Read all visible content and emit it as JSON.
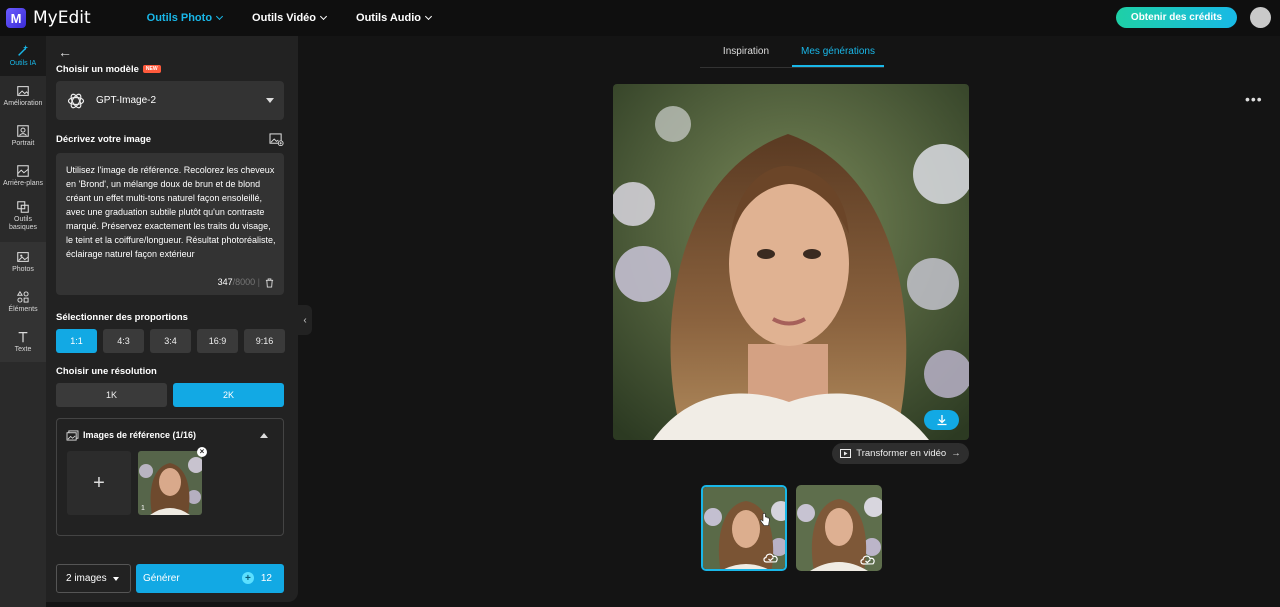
{
  "app": {
    "name": "MyEdit",
    "logo_letter": "M"
  },
  "nav": [
    {
      "label": "Outils Photo",
      "active": true
    },
    {
      "label": "Outils Vidéo",
      "active": false
    },
    {
      "label": "Outils Audio",
      "active": false
    }
  ],
  "header": {
    "credits_button": "Obtenir des crédits"
  },
  "rail": [
    {
      "label": "Outils IA",
      "icon": "magic-wand-icon",
      "active": true
    },
    {
      "label": "Amélioration",
      "icon": "image-enhance-icon"
    },
    {
      "label": "Portrait",
      "icon": "portrait-icon"
    },
    {
      "label": "Arrière-plans",
      "icon": "background-icon"
    },
    {
      "label": "Outils basiques",
      "icon": "crop-icon"
    },
    {
      "label": "Photos",
      "icon": "photos-icon"
    },
    {
      "label": "Éléments",
      "icon": "elements-icon"
    },
    {
      "label": "Texte",
      "icon": "text-icon"
    }
  ],
  "panel": {
    "model_heading": "Choisir un modèle",
    "new_badge": "NEW",
    "model_name": "GPT-Image-2",
    "describe_heading": "Décrivez votre image",
    "prompt": "Utilisez l'image de référence. Recolorez les cheveux en 'Brond', un mélange doux de brun et de blond créant un effet multi-tons naturel façon ensoleillé, avec une graduation subtile plutôt qu'un contraste marqué. Préservez exactement les traits du visage, le teint et la coiffure/longueur. Résultat photoréaliste, éclairage naturel façon extérieur",
    "char_count": "347",
    "char_max": "/8000",
    "ratio_heading": "Sélectionner des proportions",
    "ratios": [
      {
        "label": "1:1",
        "active": true
      },
      {
        "label": "4:3",
        "active": false
      },
      {
        "label": "3:4",
        "active": false
      },
      {
        "label": "16:9",
        "active": false
      },
      {
        "label": "9:16",
        "active": false
      }
    ],
    "resolution_heading": "Choisir une résolution",
    "resolutions": [
      {
        "label": "1K",
        "active": false
      },
      {
        "label": "2K",
        "active": true
      }
    ],
    "reference_title": "Images de référence (1/16)",
    "reference_add": "+",
    "reference_index": "1",
    "image_count": "2 images",
    "generate_label": "Générer",
    "generate_cost": "12"
  },
  "tabs": [
    {
      "label": "Inspiration",
      "active": false
    },
    {
      "label": "Mes générations",
      "active": true
    }
  ],
  "main": {
    "more": "•••",
    "to_video": "Transformer en vidéo"
  },
  "colors": {
    "accent": "#19b7e8",
    "button_blue": "#12a9e4",
    "bg": "#141414",
    "panel": "#222222"
  }
}
